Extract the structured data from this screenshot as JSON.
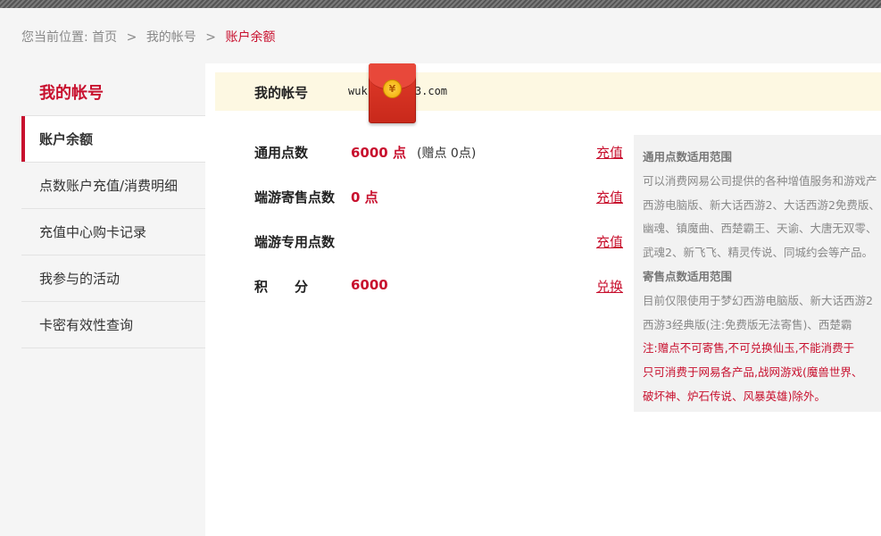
{
  "breadcrumb": {
    "prefix": "您当前位置:",
    "items": [
      "首页",
      "我的帐号",
      "账户余额"
    ],
    "separator": ">"
  },
  "sidebar": {
    "title": "我的帐号",
    "items": [
      {
        "label": "账户余额",
        "active": true
      },
      {
        "label": "点数账户充值/消费明细"
      },
      {
        "label": "充值中心购卡记录"
      },
      {
        "label": "我参与的活动"
      },
      {
        "label": "卡密有效性查询"
      }
    ]
  },
  "account": {
    "label": "我的帐号",
    "value_start": "wuk",
    "value_end": "63.com"
  },
  "hongbao": {
    "coin": "¥"
  },
  "balances": [
    {
      "label": "通用点数",
      "value": "6000 点",
      "bonus": "(赠点 0点)",
      "action": "充值"
    },
    {
      "label": "端游寄售点数",
      "value": "0 点",
      "action": "充值"
    },
    {
      "label": "端游专用点数",
      "value": "",
      "action": "充值"
    },
    {
      "label": "积　　分",
      "value": "6000",
      "action": "兑换"
    }
  ],
  "info": {
    "lines": [
      "通用点数适用范围",
      "可以消费网易公司提供的各种增值服务和游戏产",
      "西游电脑版、新大话西游2、大话西游2免费版、",
      "幽魂、镇魔曲、西楚霸王、天谕、大唐无双零、",
      "武魂2、新飞飞、精灵传说、同城约会等产品。",
      "寄售点数适用范围",
      "目前仅限使用于梦幻西游电脑版、新大话西游2",
      "西游3经典版(注:免费版无法寄售)、西楚霸",
      "注:赠点不可寄售,不可兑换仙玉,不能消费于",
      "只可消费于网易各产品,战网游戏(魔兽世界、",
      "破坏神、炉石传说、风暴英雄)除外。"
    ]
  },
  "colors": {
    "accent": "#c8102e",
    "account_bar": "#fdf8e2",
    "info_bg": "#f2f2f2"
  }
}
